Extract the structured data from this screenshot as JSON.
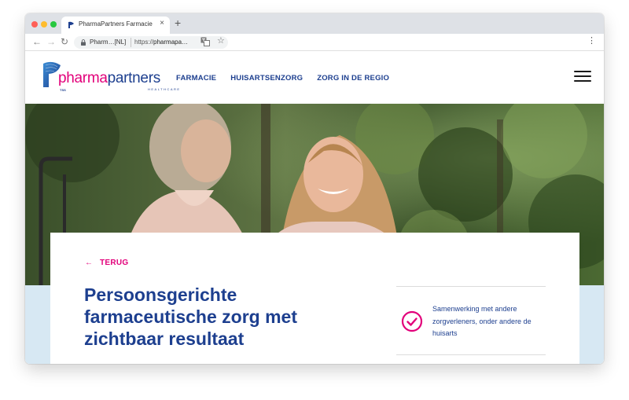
{
  "browser": {
    "tab_title": "PharmaPartners Farmacie",
    "tab_close": "×",
    "new_tab": "+",
    "site_label": "Pharm…[NL]",
    "url_prefix": "https://",
    "url_host": "pharmapa…",
    "menu": "⋮"
  },
  "site": {
    "logo": {
      "word_a": "pharma",
      "word_b": "partners",
      "sub": "HEALTHCARE",
      "badge": "TSS"
    },
    "nav": [
      {
        "label": "FARMACIE"
      },
      {
        "label": "HUISARTSENZORG"
      },
      {
        "label": "ZORG IN DE REGIO"
      }
    ],
    "back": {
      "arrow": "←",
      "label": "TERUG"
    },
    "title": "Persoonsgerichte farmaceutische zorg met zichtbaar resultaat",
    "usp": {
      "text": "Samenwerking met andere zorgverleners, onder andere de huisarts"
    }
  },
  "colors": {
    "brand_pink": "#e2007a",
    "brand_blue": "#1d3f8f",
    "band_blue": "#d7e8f3"
  }
}
